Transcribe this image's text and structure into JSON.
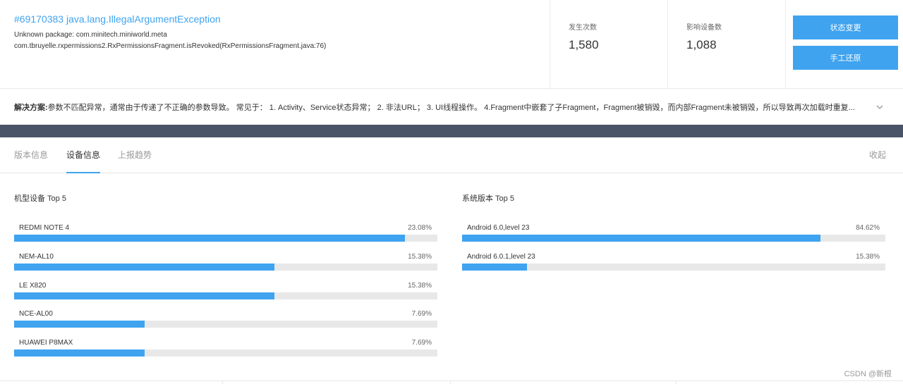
{
  "issue": {
    "title": "#69170383 java.lang.IllegalArgumentException",
    "line1": "Unknown package: com.minitech.miniworld.meta",
    "line2": "com.tbruyelle.rxpermissions2.RxPermissionsFragment.isRevoked(RxPermissionsFragment.java:76)"
  },
  "stats": {
    "occurrences_label": "发生次数",
    "occurrences_value": "1,580",
    "devices_label": "影响设备数",
    "devices_value": "1,088"
  },
  "actions": {
    "status_change": "状态变更",
    "manual_restore": "手工还原"
  },
  "solution": {
    "label": "解决方案:",
    "text": " 参数不匹配异常，通常由于传递了不正确的参数导致。 常见于： 1. Activity、Service状态异常； 2. 非法URL； 3. UI线程操作。 4.Fragment中嵌套了子Fragment，Fragment被销毁，而内部Fragment未被销毁，所以导致再次加载时重复..."
  },
  "tabs": [
    {
      "label": "版本信息"
    },
    {
      "label": "设备信息"
    },
    {
      "label": "上报趋势"
    }
  ],
  "active_tab": "设备信息",
  "collapse_label": "收起",
  "device_panel": {
    "title": "机型设备 Top 5",
    "items": [
      {
        "name": "REDMI NOTE 4",
        "percent": "23.08%",
        "fill": 0.9231
      },
      {
        "name": "NEM-AL10",
        "percent": "15.38%",
        "fill": 0.6152
      },
      {
        "name": "LE X820",
        "percent": "15.38%",
        "fill": 0.6152
      },
      {
        "name": "NCE-AL00",
        "percent": "7.69%",
        "fill": 0.3076
      },
      {
        "name": "HUAWEI P8MAX",
        "percent": "7.69%",
        "fill": 0.3076
      }
    ]
  },
  "os_panel": {
    "title": "系统版本 Top 5",
    "items": [
      {
        "name": "Android 6.0,level 23",
        "percent": "84.62%",
        "fill": 0.8462
      },
      {
        "name": "Android 6.0.1,level 23",
        "percent": "15.38%",
        "fill": 0.1538
      }
    ]
  },
  "watermark": "CSDN @新根",
  "colors": {
    "accent": "#3fa3ef",
    "track": "#e8e8e8",
    "band": "#4a5468"
  }
}
